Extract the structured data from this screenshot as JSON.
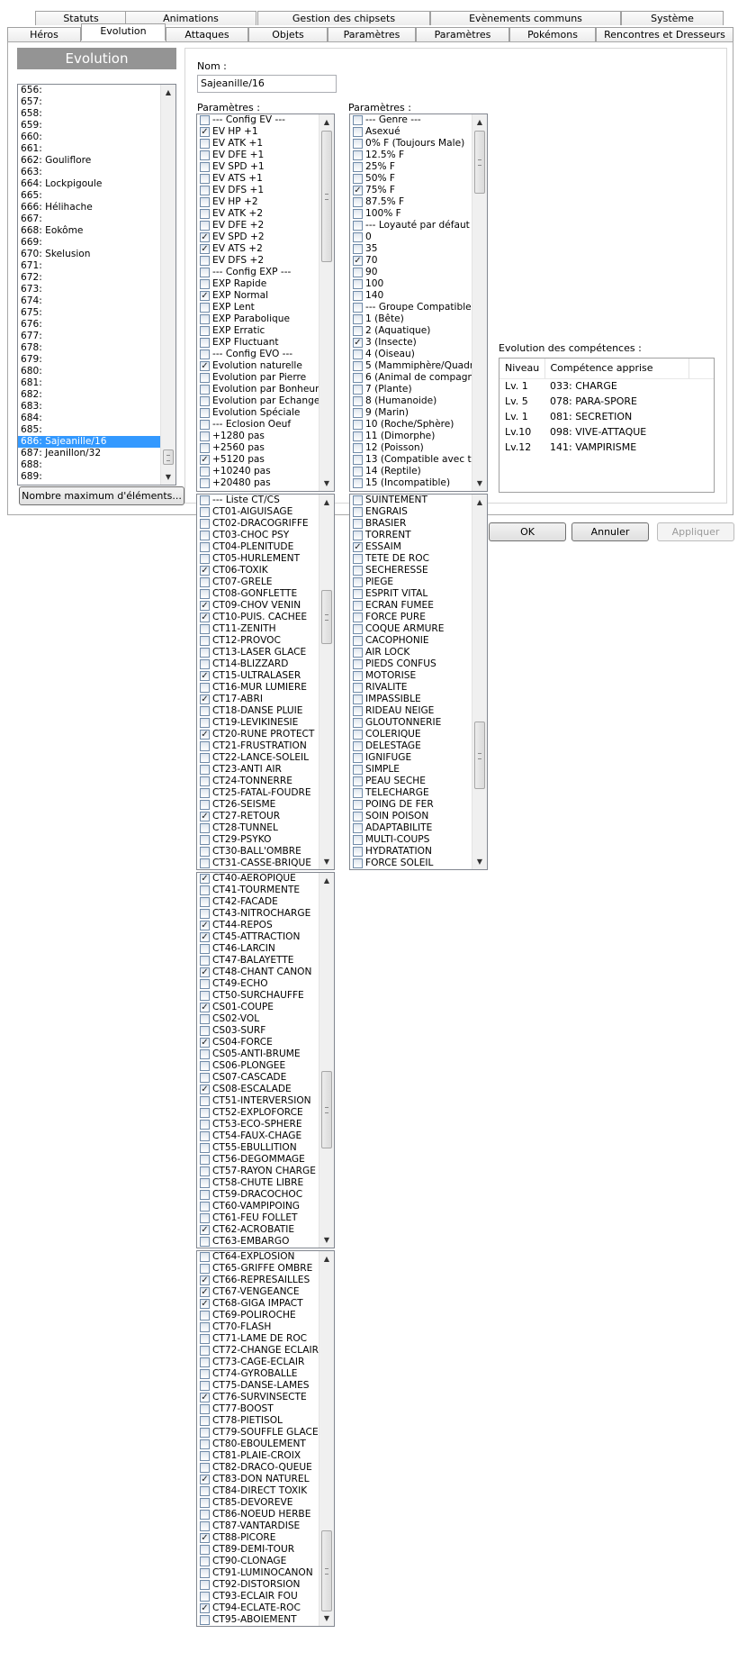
{
  "tabs_row1": [
    "Statuts",
    "Animations",
    "Gestion des chipsets",
    "Evènements communs",
    "Système"
  ],
  "tabs_row2": [
    "Héros",
    "Evolution",
    "Attaques",
    "Objets",
    "Paramètres",
    "Paramètres",
    "Pokémons",
    "Rencontres et Dresseurs"
  ],
  "active_tab": "Evolution",
  "evolution": {
    "header": "Evolution",
    "list": [
      "656:",
      "657:",
      "658:",
      "659:",
      "660:",
      "661:",
      "662: Gouliflore",
      "663:",
      "664: Lockpigoule",
      "665:",
      "666: Hélihache",
      "667:",
      "668: Eokôme",
      "669:",
      "670: Skelusion",
      "671:",
      "672:",
      "673:",
      "674:",
      "675:",
      "676:",
      "677:",
      "678:",
      "679:",
      "680:",
      "681:",
      "682:",
      "683:",
      "684:",
      "685:",
      "686: Sajeanille/16",
      "687: Jeanillon/32",
      "688:",
      "689:"
    ],
    "selected": "686: Sajeanille/16",
    "max_button": "Nombre maximum d'éléments..."
  },
  "nom": {
    "label": "Nom :",
    "value": "Sajeanille/16"
  },
  "params_label_1": "Paramètres :",
  "params_label_2": "Paramètres :",
  "params_list_1": [
    {
      "t": "--- Config EV ---",
      "c": false
    },
    {
      "t": "EV HP +1",
      "c": true
    },
    {
      "t": "EV ATK +1",
      "c": false
    },
    {
      "t": "EV DFE +1",
      "c": false
    },
    {
      "t": "EV SPD +1",
      "c": false
    },
    {
      "t": "EV ATS +1",
      "c": false
    },
    {
      "t": "EV DFS +1",
      "c": false
    },
    {
      "t": "EV HP +2",
      "c": false
    },
    {
      "t": "EV ATK +2",
      "c": false
    },
    {
      "t": "EV DFE +2",
      "c": false
    },
    {
      "t": "EV SPD +2",
      "c": true
    },
    {
      "t": "EV ATS +2",
      "c": true
    },
    {
      "t": "EV DFS +2",
      "c": false
    },
    {
      "t": "--- Config EXP ---",
      "c": false
    },
    {
      "t": "EXP Rapide",
      "c": false
    },
    {
      "t": "EXP Normal",
      "c": true
    },
    {
      "t": "EXP Lent",
      "c": false
    },
    {
      "t": "EXP Parabolique",
      "c": false
    },
    {
      "t": "EXP Erratic",
      "c": false
    },
    {
      "t": "EXP Fluctuant",
      "c": false
    },
    {
      "t": "--- Config EVO ---",
      "c": false
    },
    {
      "t": "Evolution naturelle",
      "c": true
    },
    {
      "t": "Evolution par Pierre",
      "c": false
    },
    {
      "t": "Evolution par Bonheur",
      "c": false
    },
    {
      "t": "Evolution par Echange",
      "c": false
    },
    {
      "t": "Evolution Spéciale",
      "c": false
    },
    {
      "t": "--- Eclosion Oeuf",
      "c": false
    },
    {
      "t": "+1280 pas",
      "c": false
    },
    {
      "t": "+2560 pas",
      "c": false
    },
    {
      "t": "+5120 pas",
      "c": true
    },
    {
      "t": "+10240 pas",
      "c": false
    },
    {
      "t": "+20480 pas",
      "c": false
    }
  ],
  "params_list_2": [
    {
      "t": "--- Genre ---",
      "c": false
    },
    {
      "t": "Asexué",
      "c": false
    },
    {
      "t": "0% F (Toujours Male)",
      "c": false
    },
    {
      "t": "12.5% F",
      "c": false
    },
    {
      "t": "25% F",
      "c": false
    },
    {
      "t": "50% F",
      "c": false
    },
    {
      "t": "75% F",
      "c": true
    },
    {
      "t": "87.5% F",
      "c": false
    },
    {
      "t": "100% F",
      "c": false
    },
    {
      "t": "--- Loyauté par défaut ---",
      "c": false
    },
    {
      "t": "0",
      "c": false
    },
    {
      "t": "35",
      "c": false
    },
    {
      "t": "70",
      "c": true
    },
    {
      "t": "90",
      "c": false
    },
    {
      "t": "100",
      "c": false
    },
    {
      "t": "140",
      "c": false
    },
    {
      "t": "--- Groupe Compatible ---",
      "c": false
    },
    {
      "t": "1 (Bête)",
      "c": false
    },
    {
      "t": "2 (Aquatique)",
      "c": false
    },
    {
      "t": "3 (Insecte)",
      "c": true
    },
    {
      "t": "4 (Oiseau)",
      "c": false
    },
    {
      "t": "5 (Mammiphère/Quadrup",
      "c": false
    },
    {
      "t": "6 (Animal de compagnie)",
      "c": false
    },
    {
      "t": "7 (Plante)",
      "c": false
    },
    {
      "t": "8 (Humanoide)",
      "c": false
    },
    {
      "t": "9 (Marin)",
      "c": false
    },
    {
      "t": "10 (Roche/Sphère)",
      "c": false
    },
    {
      "t": "11 (Dimorphe)",
      "c": false
    },
    {
      "t": "12 (Poisson)",
      "c": false
    },
    {
      "t": "13 (Compatible avec tous",
      "c": false
    },
    {
      "t": "14 (Reptile)",
      "c": false
    },
    {
      "t": "15 (Incompatible)",
      "c": false
    }
  ],
  "ct_list_1": [
    {
      "t": "--- Liste CT/CS",
      "c": false
    },
    {
      "t": "CT01-AIGUISAGE",
      "c": false
    },
    {
      "t": "CT02-DRACOGRIFFE",
      "c": false
    },
    {
      "t": "CT03-CHOC PSY",
      "c": false
    },
    {
      "t": "CT04-PLENITUDE",
      "c": false
    },
    {
      "t": "CT05-HURLEMENT",
      "c": false
    },
    {
      "t": "CT06-TOXIK",
      "c": true
    },
    {
      "t": "CT07-GRELE",
      "c": false
    },
    {
      "t": "CT08-GONFLETTE",
      "c": false
    },
    {
      "t": "CT09-CHOV VENIN",
      "c": true
    },
    {
      "t": "CT10-PUIS. CACHEE",
      "c": true
    },
    {
      "t": "CT11-ZENITH",
      "c": false
    },
    {
      "t": "CT12-PROVOC",
      "c": false
    },
    {
      "t": "CT13-LASER GLACE",
      "c": false
    },
    {
      "t": "CT14-BLIZZARD",
      "c": false
    },
    {
      "t": "CT15-ULTRALASER",
      "c": true
    },
    {
      "t": "CT16-MUR LUMIERE",
      "c": false
    },
    {
      "t": "CT17-ABRI",
      "c": true
    },
    {
      "t": "CT18-DANSE PLUIE",
      "c": false
    },
    {
      "t": "CT19-LEVIKINESIE",
      "c": false
    },
    {
      "t": "CT20-RUNE PROTECT",
      "c": true
    },
    {
      "t": "CT21-FRUSTRATION",
      "c": false
    },
    {
      "t": "CT22-LANCE-SOLEIL",
      "c": false
    },
    {
      "t": "CT23-ANTI AIR",
      "c": false
    },
    {
      "t": "CT24-TONNERRE",
      "c": false
    },
    {
      "t": "CT25-FATAL-FOUDRE",
      "c": false
    },
    {
      "t": "CT26-SEISME",
      "c": false
    },
    {
      "t": "CT27-RETOUR",
      "c": true
    },
    {
      "t": "CT28-TUNNEL",
      "c": false
    },
    {
      "t": "CT29-PSYKO",
      "c": false
    },
    {
      "t": "CT30-BALL'OMBRE",
      "c": false
    },
    {
      "t": "CT31-CASSE-BRIQUE",
      "c": false
    }
  ],
  "talent_list": [
    {
      "t": "SUINTEMENT",
      "c": false
    },
    {
      "t": "ENGRAIS",
      "c": false
    },
    {
      "t": "BRASIER",
      "c": false
    },
    {
      "t": "TORRENT",
      "c": false
    },
    {
      "t": "ESSAIM",
      "c": true
    },
    {
      "t": "TETE DE ROC",
      "c": false
    },
    {
      "t": "SECHERESSE",
      "c": false
    },
    {
      "t": "PIEGE",
      "c": false
    },
    {
      "t": "ESPRIT VITAL",
      "c": false
    },
    {
      "t": "ECRAN FUMEE",
      "c": false
    },
    {
      "t": "FORCE PURE",
      "c": false
    },
    {
      "t": "COQUE ARMURE",
      "c": false
    },
    {
      "t": "CACOPHONIE",
      "c": false
    },
    {
      "t": "AIR LOCK",
      "c": false
    },
    {
      "t": "PIEDS CONFUS",
      "c": false
    },
    {
      "t": "MOTORISE",
      "c": false
    },
    {
      "t": "RIVALITE",
      "c": false
    },
    {
      "t": "IMPASSIBLE",
      "c": false
    },
    {
      "t": "RIDEAU NEIGE",
      "c": false
    },
    {
      "t": "GLOUTONNERIE",
      "c": false
    },
    {
      "t": "COLERIQUE",
      "c": false
    },
    {
      "t": "DELESTAGE",
      "c": false
    },
    {
      "t": "IGNIFUGE",
      "c": false
    },
    {
      "t": "SIMPLE",
      "c": false
    },
    {
      "t": "PEAU SECHE",
      "c": false
    },
    {
      "t": "TELECHARGE",
      "c": false
    },
    {
      "t": "POING DE FER",
      "c": false
    },
    {
      "t": "SOIN POISON",
      "c": false
    },
    {
      "t": "ADAPTABILITE",
      "c": false
    },
    {
      "t": "MULTI-COUPS",
      "c": false
    },
    {
      "t": "HYDRATATION",
      "c": false
    },
    {
      "t": "FORCE SOLEIL",
      "c": false
    }
  ],
  "ct_list_2": [
    {
      "t": "CT40-AEROPIQUE",
      "c": true
    },
    {
      "t": "CT41-TOURMENTE",
      "c": false
    },
    {
      "t": "CT42-FACADE",
      "c": false
    },
    {
      "t": "CT43-NITROCHARGE",
      "c": false
    },
    {
      "t": "CT44-REPOS",
      "c": true
    },
    {
      "t": "CT45-ATTRACTION",
      "c": true
    },
    {
      "t": "CT46-LARCIN",
      "c": false
    },
    {
      "t": "CT47-BALAYETTE",
      "c": false
    },
    {
      "t": "CT48-CHANT CANON",
      "c": true
    },
    {
      "t": "CT49-ECHO",
      "c": false
    },
    {
      "t": "CT50-SURCHAUFFE",
      "c": false
    },
    {
      "t": "CS01-COUPE",
      "c": true
    },
    {
      "t": "CS02-VOL",
      "c": false
    },
    {
      "t": "CS03-SURF",
      "c": false
    },
    {
      "t": "CS04-FORCE",
      "c": true
    },
    {
      "t": "CS05-ANTI-BRUME",
      "c": false
    },
    {
      "t": "CS06-PLONGEE",
      "c": false
    },
    {
      "t": "CS07-CASCADE",
      "c": false
    },
    {
      "t": "CS08-ESCALADE",
      "c": true
    },
    {
      "t": "CT51-INTERVERSION",
      "c": false
    },
    {
      "t": "CT52-EXPLOFORCE",
      "c": false
    },
    {
      "t": "CT53-ECO-SPHERE",
      "c": false
    },
    {
      "t": "CT54-FAUX-CHAGE",
      "c": false
    },
    {
      "t": "CT55-EBULLITION",
      "c": false
    },
    {
      "t": "CT56-DEGOMMAGE",
      "c": false
    },
    {
      "t": "CT57-RAYON CHARGE",
      "c": false
    },
    {
      "t": "CT58-CHUTE LIBRE",
      "c": false
    },
    {
      "t": "CT59-DRACOCHOC",
      "c": false
    },
    {
      "t": "CT60-VAMPIPOING",
      "c": false
    },
    {
      "t": "CT61-FEU FOLLET",
      "c": false
    },
    {
      "t": "CT62-ACROBATIE",
      "c": true
    },
    {
      "t": "CT63-EMBARGO",
      "c": false
    }
  ],
  "ct_list_3": [
    {
      "t": "CT64-EXPLOSION",
      "c": false
    },
    {
      "t": "CT65-GRIFFE OMBRE",
      "c": false
    },
    {
      "t": "CT66-REPRESAILLES",
      "c": true
    },
    {
      "t": "CT67-VENGEANCE",
      "c": true
    },
    {
      "t": "CT68-GIGA IMPACT",
      "c": true
    },
    {
      "t": "CT69-POLIROCHE",
      "c": false
    },
    {
      "t": "CT70-FLASH",
      "c": false
    },
    {
      "t": "CT71-LAME DE ROC",
      "c": false
    },
    {
      "t": "CT72-CHANGE ECLAIR",
      "c": false
    },
    {
      "t": "CT73-CAGE-ECLAIR",
      "c": false
    },
    {
      "t": "CT74-GYROBALLE",
      "c": false
    },
    {
      "t": "CT75-DANSE-LAMES",
      "c": false
    },
    {
      "t": "CT76-SURVINSECTE",
      "c": true
    },
    {
      "t": "CT77-BOOST",
      "c": false
    },
    {
      "t": "CT78-PIETISOL",
      "c": false
    },
    {
      "t": "CT79-SOUFFLE GLACE",
      "c": false
    },
    {
      "t": "CT80-EBOULEMENT",
      "c": false
    },
    {
      "t": "CT81-PLAIE-CROIX",
      "c": false
    },
    {
      "t": "CT82-DRACO-QUEUE",
      "c": false
    },
    {
      "t": "CT83-DON NATUREL",
      "c": true
    },
    {
      "t": "CT84-DIRECT TOXIK",
      "c": false
    },
    {
      "t": "CT85-DEVOREVE",
      "c": false
    },
    {
      "t": "CT86-NOEUD HERBE",
      "c": false
    },
    {
      "t": "CT87-VANTARDISE",
      "c": false
    },
    {
      "t": "CT88-PICORE",
      "c": true
    },
    {
      "t": "CT89-DEMI-TOUR",
      "c": false
    },
    {
      "t": "CT90-CLONAGE",
      "c": false
    },
    {
      "t": "CT91-LUMINOCANON",
      "c": false
    },
    {
      "t": "CT92-DISTORSION",
      "c": false
    },
    {
      "t": "CT93-ECLAIR FOU",
      "c": false
    },
    {
      "t": "CT94-ECLATE-ROC",
      "c": true
    },
    {
      "t": "CT95-ABOIEMENT",
      "c": false
    }
  ],
  "competences": {
    "label": "Evolution des compétences :",
    "col_niveau": "Niveau",
    "col_comp": "Compétence apprise",
    "rows": [
      [
        "Lv. 1",
        "033: CHARGE"
      ],
      [
        "Lv. 5",
        "078: PARA-SPORE"
      ],
      [
        "Lv. 1",
        "081: SECRETION"
      ],
      [
        "Lv.10",
        "098: VIVE-ATTAQUE"
      ],
      [
        "Lv.12",
        "141: VAMPIRISME"
      ]
    ]
  },
  "buttons": {
    "ok": "OK",
    "cancel": "Annuler",
    "apply": "Appliquer"
  }
}
